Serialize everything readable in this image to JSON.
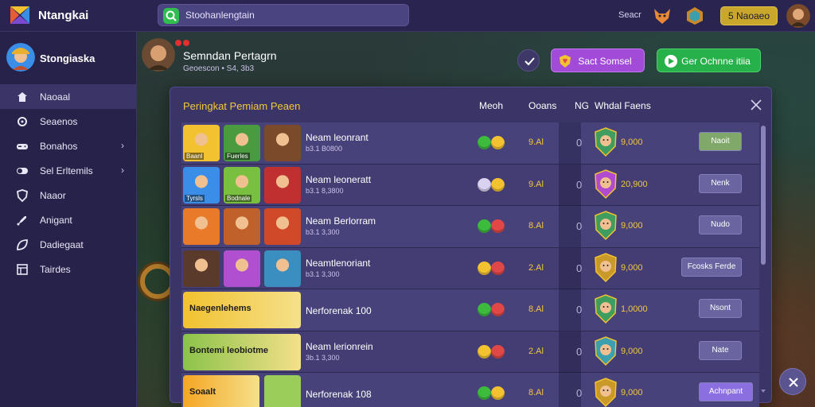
{
  "app": {
    "title": "Ntangkai"
  },
  "search": {
    "text": "Stoohanlengtain"
  },
  "topbar": {
    "label": "Seacr",
    "button_label": "5  Naoaeo"
  },
  "sidebar": {
    "profile_name": "Stongiaska",
    "items": [
      {
        "label": "Naoaal",
        "icon": "home-icon",
        "active": true,
        "chevron": false
      },
      {
        "label": "Seaenos",
        "icon": "settings-icon",
        "active": false,
        "chevron": false
      },
      {
        "label": "Bonahos",
        "icon": "gamepad-icon",
        "active": false,
        "chevron": true
      },
      {
        "label": "Sel Erltemils",
        "icon": "toggle-icon",
        "active": false,
        "chevron": true
      },
      {
        "label": "Naaor",
        "icon": "shield-icon",
        "active": false,
        "chevron": false
      },
      {
        "label": "Anigant",
        "icon": "rocket-icon",
        "active": false,
        "chevron": false
      },
      {
        "label": "Dadiegaat",
        "icon": "leaf-icon",
        "active": false,
        "chevron": false
      },
      {
        "label": "Tairdes",
        "icon": "table-icon",
        "active": false,
        "chevron": false
      }
    ]
  },
  "event": {
    "title": "Semndan Pertagrn",
    "subtitle": "Geoescon • S4, 3b3",
    "purple_button": "Sact Somsel",
    "green_button": "Ger Ochnne itiia"
  },
  "modal": {
    "title": "Peringkat Pemiam Peaen",
    "columns": [
      "Meoh",
      "Ooans",
      "NG",
      "Whdal Faens"
    ],
    "rows": [
      {
        "name": "Neam leonrant",
        "sub": "b3.1 B0800",
        "thumb_caption": "Baanl",
        "thumb_caption2": "Fuerles",
        "face_a": "#3dbb3d",
        "face_b": "#f2c230",
        "value": "9.Al",
        "count": "0",
        "reward": "9,000",
        "button": "Naoit",
        "button_color": "#7fa86a",
        "shield": "#3f9d60",
        "banner": null
      },
      {
        "name": "Neam leoneratt",
        "sub": "b3.1 8,3800",
        "thumb_caption": "Tyrsls",
        "thumb_caption2": "Bodnale",
        "face_a": "#d9d2f0",
        "face_b": "#f2c230",
        "value": "9.Al",
        "count": "0",
        "reward": "20,900",
        "button": "Nenk",
        "button_color": "#6a65a0",
        "shield": "#b04bd0",
        "banner": null
      },
      {
        "name": "Neam Berlorram",
        "sub": "b3.1 3,300",
        "thumb_caption": "",
        "thumb_caption2": "",
        "face_a": "#3dbb3d",
        "face_b": "#e04848",
        "value": "8.Al",
        "count": "0",
        "reward": "9,000",
        "button": "Nudo",
        "button_color": "#6a65a0",
        "shield": "#3f9d60",
        "banner": null
      },
      {
        "name": "Neamtlenoriant",
        "sub": "b3.1 3,300",
        "thumb_caption": "",
        "thumb_caption2": "",
        "face_a": "#f2c230",
        "face_b": "#e04848",
        "value": "2.Al",
        "count": "0",
        "reward": "9,000",
        "button": "Fcosks Ferde",
        "button_color": "#6a65a0",
        "shield": "#c99a2a",
        "banner": null
      },
      {
        "name": "Nerforenak 100",
        "sub": "",
        "thumb_caption": "",
        "thumb_caption2": "",
        "face_a": "#3dbb3d",
        "face_b": "#e04848",
        "value": "8.Al",
        "count": "0",
        "reward": "1,0000",
        "button": "Nsont",
        "button_color": "#6a65a0",
        "shield": "#3f9d60",
        "banner": {
          "text": "Naegenlehems",
          "color": "#f2c230"
        }
      },
      {
        "name": "Neam lerionrein",
        "sub": "3b.1 3,300",
        "thumb_caption": "",
        "thumb_caption2": "",
        "face_a": "#f2c230",
        "face_b": "#e04848",
        "value": "2.Al",
        "count": "0",
        "reward": "9,000",
        "button": "Nate",
        "button_color": "#6a65a0",
        "shield": "#3aa0b0",
        "banner": {
          "text": "Bontemi leobiotme",
          "color": "#8bc34a"
        }
      },
      {
        "name": "Nerforenak 108",
        "sub": "",
        "thumb_caption": "",
        "thumb_caption2": "",
        "face_a": "#3dbb3d",
        "face_b": "#f2c230",
        "value": "8.Al",
        "count": "0",
        "reward": "9,000",
        "button": "Achnpant",
        "button_color": "#8b6fe0",
        "shield": "#c99a2a",
        "banner": {
          "text": "Soaalt",
          "color": "#f5a623"
        }
      }
    ]
  },
  "colors": {
    "accent_gold": "#f2c83c",
    "accent_purple": "#a34bd9",
    "accent_green": "#26b14b"
  }
}
